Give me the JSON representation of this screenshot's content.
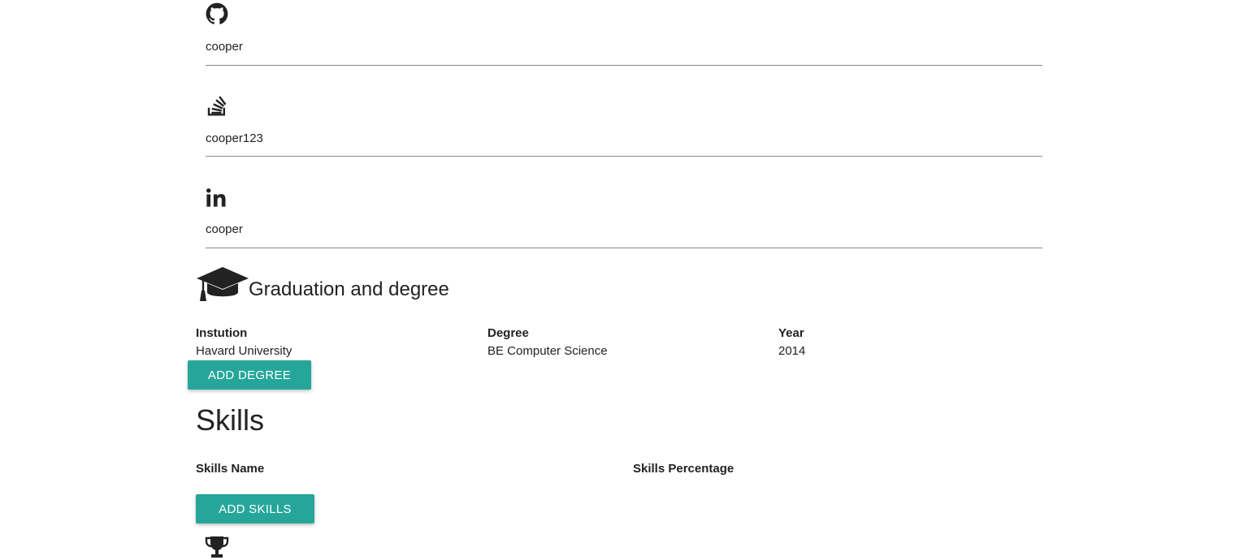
{
  "social": {
    "github": {
      "icon": "github-icon",
      "value": "cooper"
    },
    "stackoverflow": {
      "icon": "stackoverflow-icon",
      "value": "cooper123"
    },
    "linkedin": {
      "icon": "linkedin-icon",
      "value": "cooper"
    }
  },
  "graduation": {
    "icon": "graduation-cap-icon",
    "title": "Graduation and degree",
    "columns": [
      "Instution",
      "Degree",
      "Year"
    ],
    "rows": [
      [
        "Havard University",
        "BE Computer Science",
        "2014"
      ]
    ],
    "add_button_label": "ADD DEGREE"
  },
  "skills": {
    "title": "Skills",
    "columns": [
      "Skills Name",
      "Skills Percentage"
    ],
    "add_button_label": "ADD SKILLS"
  },
  "awards": {
    "icon": "trophy-icon"
  },
  "colors": {
    "accent": "#26a69a",
    "divider": "#8a8a8a",
    "text": "#212121"
  }
}
